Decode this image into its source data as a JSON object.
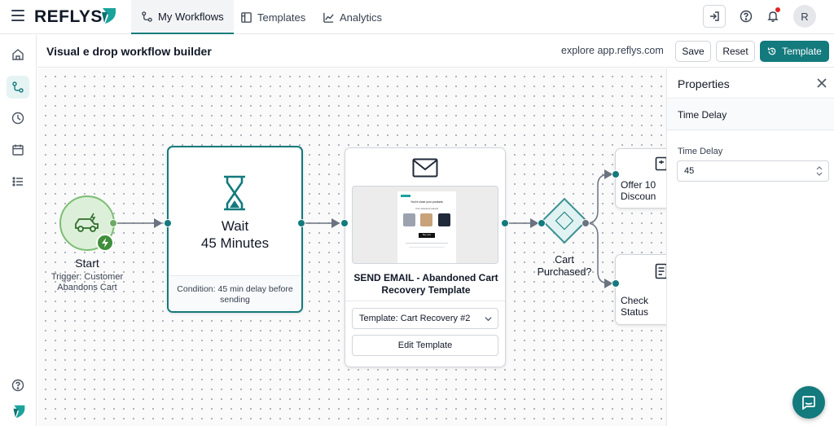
{
  "app": {
    "name": "REFLYS"
  },
  "nav": {
    "tabs": [
      {
        "label": "My Workflows",
        "icon": "workflow-icon",
        "active": true
      },
      {
        "label": "Templates",
        "icon": "template-icon",
        "active": false
      },
      {
        "label": "Analytics",
        "icon": "analytics-icon",
        "active": false
      }
    ],
    "avatar_initial": "R"
  },
  "header": {
    "title": "Visual e drop workflow builder",
    "explore": "explore app.reflys.com",
    "save_label": "Save",
    "reset_label": "Reset",
    "template_label": "Template"
  },
  "workflow": {
    "start": {
      "title": "Start",
      "subtitle": "Trigger: Customer Abandons Cart"
    },
    "wait": {
      "title_line1": "Wait",
      "title_line2": "45 Minutes",
      "condition": "Condition: 45 min delay before sending"
    },
    "email": {
      "title": "SEND EMAIL - Abandoned Cart Recovery Template",
      "template_select": "Template: Cart Recovery #2",
      "edit_label": "Edit Template",
      "preview": {
        "heading": "You're close your products",
        "subheading": "Your selected products",
        "button": "Buy now"
      }
    },
    "decision": {
      "label": "Cart Purchased?"
    },
    "offer": {
      "line1": "Offer 10",
      "line2": "Discoun"
    },
    "check": {
      "line1": "Check",
      "line2": "Status"
    }
  },
  "properties": {
    "title": "Properties",
    "section": "Time Delay",
    "field_label": "Time Delay",
    "field_value": "45"
  },
  "colors": {
    "accent": "#137a7d",
    "start_green": "#6cab63",
    "notification": "#dc2626"
  }
}
